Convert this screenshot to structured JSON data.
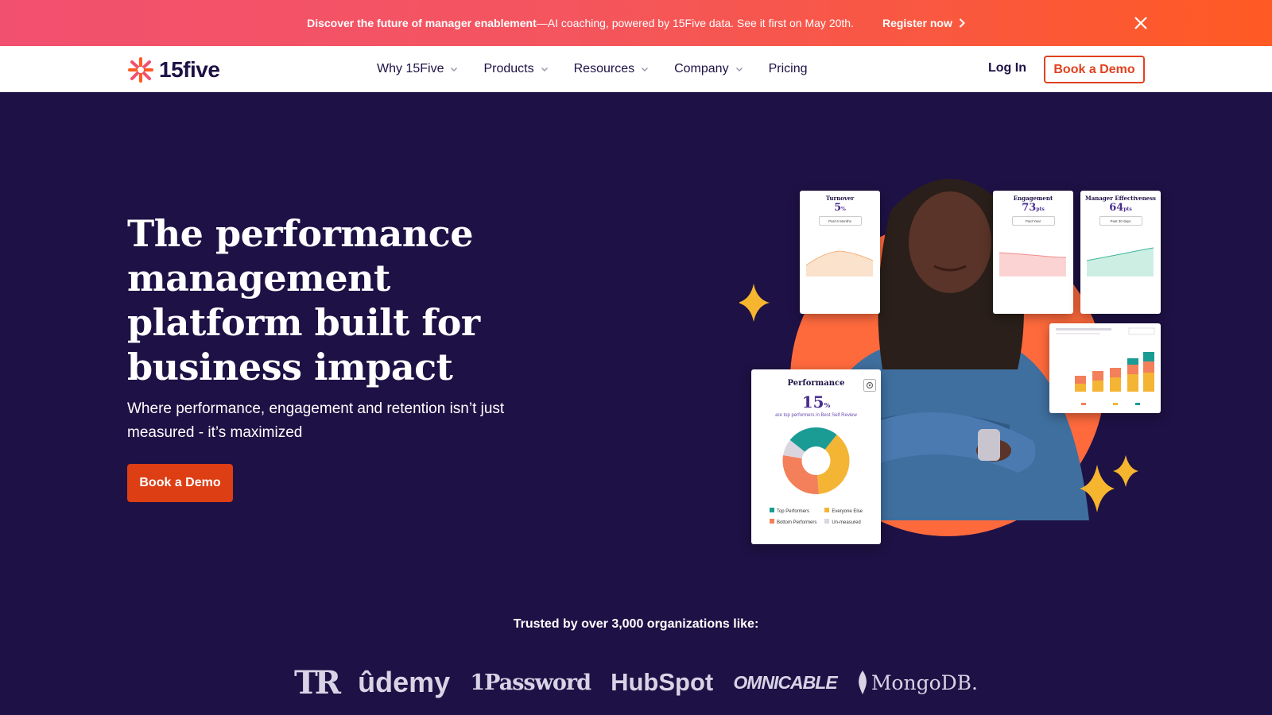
{
  "promo": {
    "bold": "Discover the future of manager enablement",
    "rest": "—AI coaching, powered by 15Five data. See it first on May 20th.",
    "link": "Register now"
  },
  "nav": {
    "logo": "15five",
    "items": [
      {
        "label": "Why 15Five",
        "dropdown": true
      },
      {
        "label": "Products",
        "dropdown": true
      },
      {
        "label": "Resources",
        "dropdown": true
      },
      {
        "label": "Company",
        "dropdown": true
      },
      {
        "label": "Pricing",
        "dropdown": false
      }
    ],
    "login": "Log In",
    "demo": "Book a Demo"
  },
  "hero": {
    "title": "The performance management platform built for business impact",
    "subtitle": "Where performance, engagement and retention isn’t just measured - it’s maximized",
    "cta": "Book a Demo"
  },
  "cards": {
    "turnover": {
      "title": "Turnover",
      "value": "5",
      "unit": "%",
      "pill": "Past 6 Months"
    },
    "engagement": {
      "title": "Engagement",
      "value": "73",
      "unit": "pts",
      "pill": "Past Year"
    },
    "manager": {
      "title": "Manager Effectiveness",
      "value": "64",
      "unit": "pts",
      "pill": "Past 30 days"
    },
    "performance": {
      "title": "Performance",
      "value": "15",
      "unit": "%",
      "note": "are top performers in Best Self Review",
      "legend": [
        "Top Performers",
        "Everyone Else",
        "Bottom Performers",
        "Un-measured"
      ],
      "slices": [
        {
          "label": "Top Performers",
          "value": 25,
          "color": "#1a9b94"
        },
        {
          "label": "Everyone Else",
          "value": 38,
          "color": "#f4b434"
        },
        {
          "label": "Bottom Performers",
          "value": 29,
          "color": "#f37f5b"
        },
        {
          "label": "Un-measured",
          "value": 8,
          "color": "#d9d6e0"
        }
      ]
    }
  },
  "colors": {
    "accent": "#dd3e14",
    "bg": "#1e1145",
    "orange": "#ff6a3d",
    "star": "#f6b52e"
  },
  "trusted": {
    "text": "Trusted by over 3,000 organizations like:",
    "logos": [
      "TR",
      "ûdemy",
      "1Password",
      "HubSpot",
      "OMNICABLE",
      "MongoDB."
    ]
  }
}
